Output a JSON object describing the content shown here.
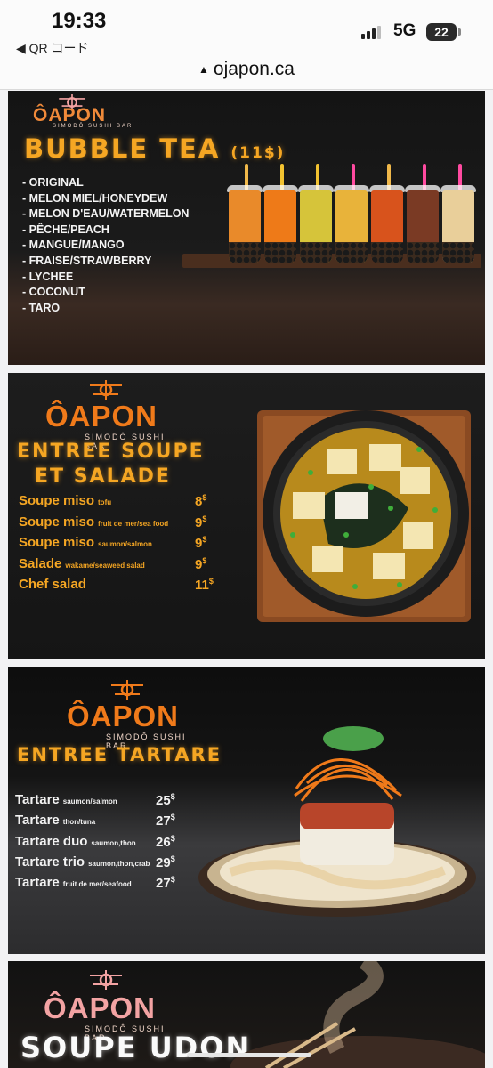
{
  "status_bar": {
    "time": "19:33",
    "back_label": "◀ QR コード",
    "network": "5G",
    "battery": "22"
  },
  "browser": {
    "url": "ojapon.ca",
    "lock_icon": "▲"
  },
  "brand": {
    "name": "ÔAPON",
    "tagline": "SIMODÔ SUSHI BAR",
    "accent": "#f5a623",
    "logo_orange": "#f07a1a",
    "logo_pink": "#f3a3a3"
  },
  "bubble_tea": {
    "title": "BUBBLE TEA",
    "price": "(11$)",
    "flavors": [
      "- ORIGINAL",
      "- MELON MIEL/HONEYDEW",
      "- MELON D'EAU/WATERMELON",
      "- PÊCHE/PEACH",
      "- MANGUE/MANGO",
      "- FRAISE/STRAWBERRY",
      "- LYCHEE",
      "- COCONUT",
      "- TARO"
    ],
    "cup_colors": [
      "#e98a2a",
      "#ee7a18",
      "#d6c43a",
      "#e8b33a",
      "#d8531c",
      "#7a3a24",
      "#e9cf9a"
    ],
    "straw_colors": [
      "#f0b84a",
      "#f2c230",
      "#f2c230",
      "#ff4aa0",
      "#f0b84a",
      "#ff4aa0",
      "#ff4aa0"
    ]
  },
  "soup_salad": {
    "title_line1": "ENTREE SOUPE",
    "title_line2": "ET SALADE",
    "items": [
      {
        "name": "Soupe miso",
        "sub": "tofu",
        "price": "8",
        "cur": "$"
      },
      {
        "name": "Soupe miso",
        "sub": "fruit de mer/sea food",
        "price": "9",
        "cur": "$"
      },
      {
        "name": "Soupe miso",
        "sub": "saumon/salmon",
        "price": "9",
        "cur": "$"
      },
      {
        "name": "Salade",
        "sub": "wakame/seaweed salad",
        "price": "9",
        "cur": "$"
      },
      {
        "name": "Chef salad",
        "sub": "",
        "price": "11",
        "cur": "$"
      }
    ]
  },
  "tartare": {
    "title": "ENTREE TARTARE",
    "items": [
      {
        "name": "Tartare",
        "sub": "saumon/salmon",
        "price": "25",
        "cur": "$"
      },
      {
        "name": "Tartare",
        "sub": "thon/tuna",
        "price": "27",
        "cur": "$"
      },
      {
        "name": "Tartare duo",
        "sub": "saumon,thon",
        "price": "26",
        "cur": "$"
      },
      {
        "name": "Tartare trio",
        "sub": "saumon,thon,crab",
        "price": "29",
        "cur": "$"
      },
      {
        "name": "Tartare",
        "sub": "fruit de mer/seafood",
        "price": "27",
        "cur": "$"
      }
    ]
  },
  "udon": {
    "title": "SOUPE UDON"
  }
}
